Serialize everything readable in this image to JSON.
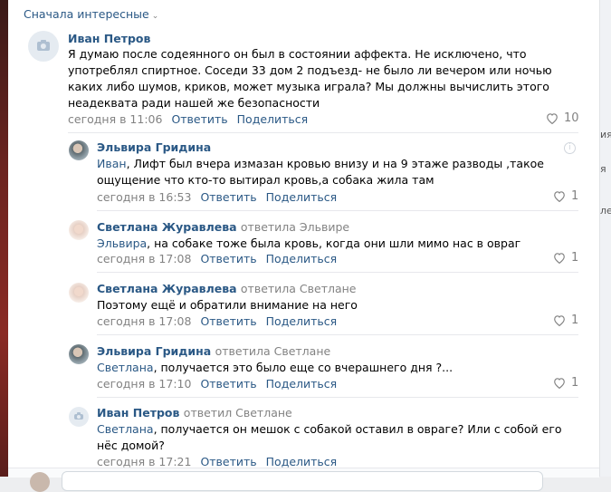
{
  "sort_label": "Сначала интересные",
  "right_strip": [
    "ия",
    "я",
    "ле"
  ],
  "comments": [
    {
      "author": "Иван Петров",
      "reply_to": "",
      "mention": "",
      "text": "Я думаю после содеянного он был в состоянии аффекта. Не исключено, что употреблял спиртное. Соседи 33 дом 2 подъезд- не было ли вечером или ночью каких либо шумов, криков, может музыка играла? Мы должны вычислить этого неадеквата ради нашей же безопасности",
      "time": "сегодня в 11:06",
      "reply_label": "Ответить",
      "share_label": "Поделиться",
      "likes": "10"
    },
    {
      "author": "Эльвира Гридина",
      "reply_to": "",
      "mention": "Иван",
      "text": ", Лифт был вчера измазан кровью внизу и на 9 этаже разводы ,такое ощущение что кто-то вытирал кровь,а собака жила там",
      "time": "сегодня в 16:53",
      "reply_label": "Ответить",
      "share_label": "Поделиться",
      "likes": "1"
    },
    {
      "author": "Светлана Журавлева",
      "reply_to": "ответила Эльвире",
      "mention": "Эльвира",
      "text": ", на собаке тоже была кровь, когда они шли мимо нас в овраг",
      "time": "сегодня в 17:08",
      "reply_label": "Ответить",
      "share_label": "Поделиться",
      "likes": "1"
    },
    {
      "author": "Светлана Журавлева",
      "reply_to": "ответила Светлане",
      "mention": "",
      "text": "Поэтому ещё и обратили внимание на него",
      "time": "сегодня в 17:08",
      "reply_label": "Ответить",
      "share_label": "Поделиться",
      "likes": "1"
    },
    {
      "author": "Эльвира Гридина",
      "reply_to": "ответила Светлане",
      "mention": "Светлана",
      "text": ", получается это было еще со вчерашнего дня ?...",
      "time": "сегодня в 17:10",
      "reply_label": "Ответить",
      "share_label": "Поделиться",
      "likes": "1"
    },
    {
      "author": "Иван Петров",
      "reply_to": "ответил Светлане",
      "mention": "Светлана",
      "text": ", получается он мешок с собакой оставил в овраге? Или с собой его нёс домой?",
      "time": "сегодня в 17:21",
      "reply_label": "Ответить",
      "share_label": "Поделиться",
      "likes": ""
    }
  ]
}
